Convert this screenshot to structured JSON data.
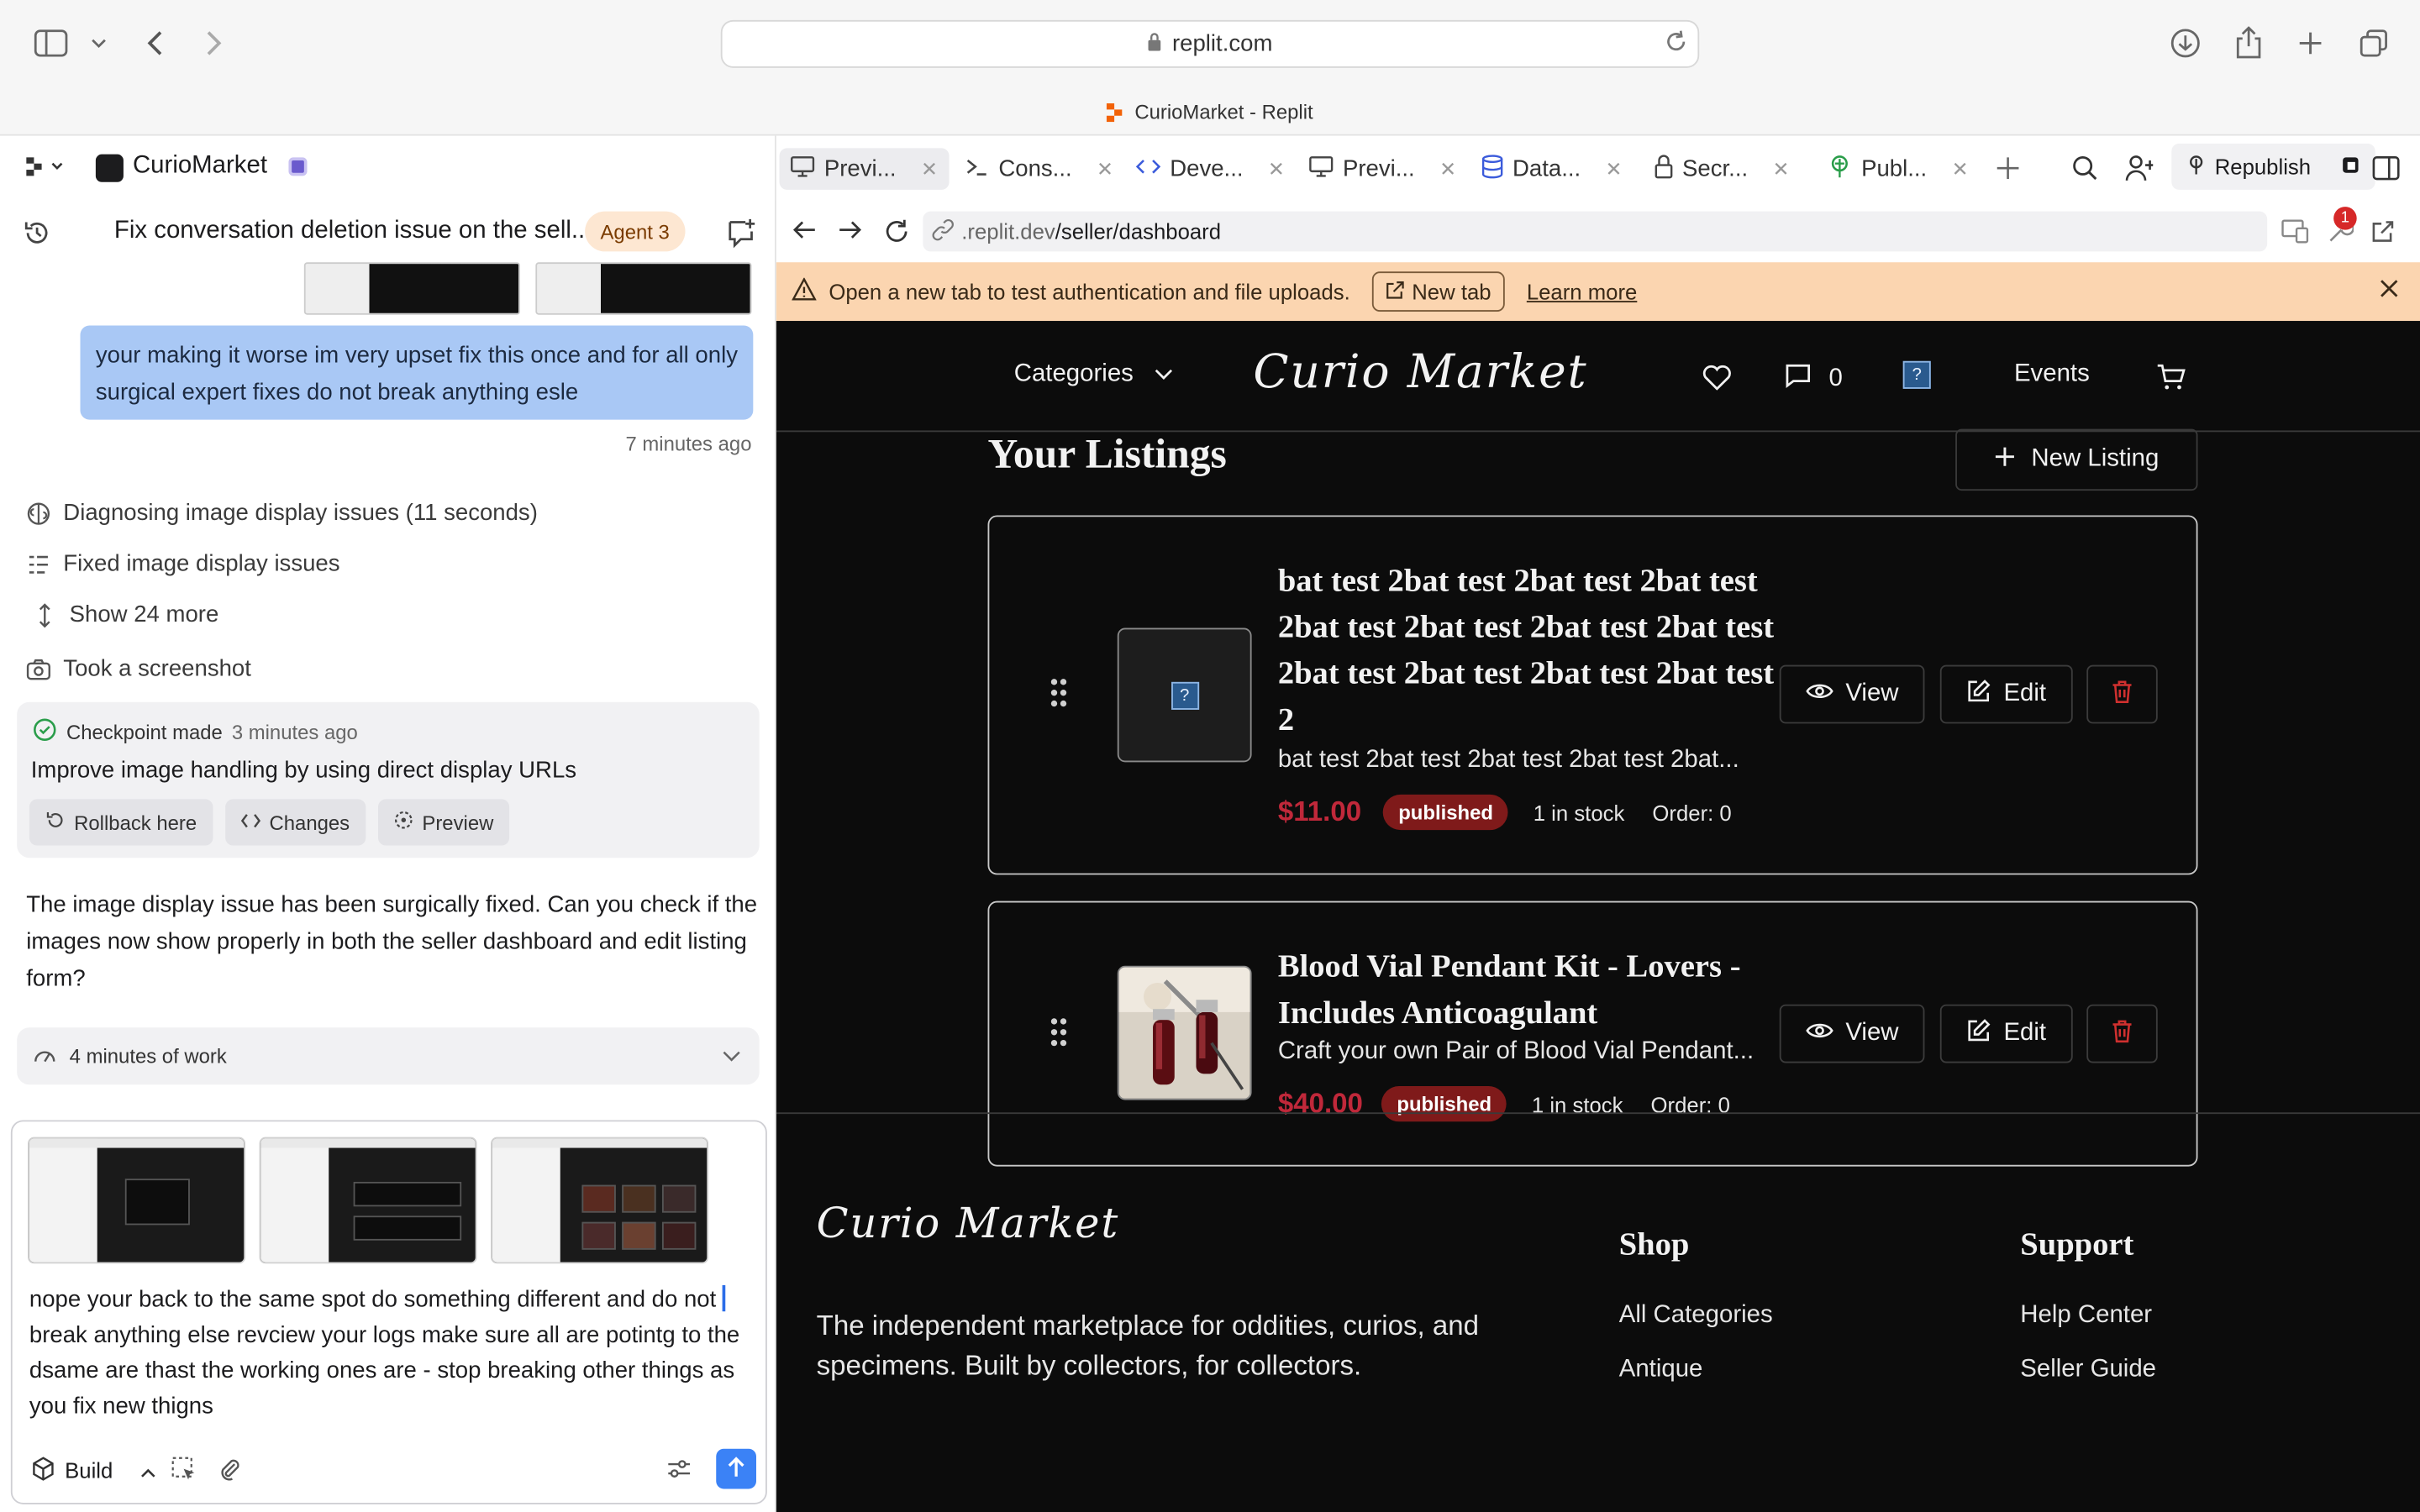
{
  "browser": {
    "url": "replit.com",
    "page_title": "CurioMarket - Replit"
  },
  "sidebar": {
    "project_name": "CurioMarket",
    "chat_title": "Fix conversation deletion issue on the sell...",
    "agent_badge": "Agent 3",
    "user_message": "your making it worse im very upset fix this once and for all only surgical expert fixes do not break anything esle",
    "user_message_time": "7 minutes ago",
    "steps": [
      {
        "icon": "brain-icon",
        "label": "Diagnosing image display issues (11 seconds)"
      },
      {
        "icon": "list-icon",
        "label": "Fixed image display issues"
      },
      {
        "icon": "expand-icon",
        "label": "Show 24 more"
      },
      {
        "icon": "camera-icon",
        "label": "Took a screenshot"
      }
    ],
    "checkpoint": {
      "label": "Checkpoint made",
      "time": "3 minutes ago",
      "title": "Improve image handling by using direct display URLs",
      "buttons": [
        "Rollback here",
        "Changes",
        "Preview"
      ]
    },
    "agent_message": "The image display issue has been surgically fixed. Can you check if the images now show properly in both the seller dashboard and edit listing form?",
    "work_summary": "4 minutes of work",
    "composer": {
      "text_before_caret": "nope your back to the same spot do something different and do not ",
      "text_after_caret": "break anything else revciew your logs make sure all are potintg to the dsame are thast the working ones are - stop breaking other things as you fix new thigns",
      "mode": "Build"
    }
  },
  "tabs": [
    {
      "icon": "monitor-icon",
      "label": "Previ...",
      "active": true
    },
    {
      "icon": "terminal-icon",
      "label": "Cons...",
      "active": false
    },
    {
      "icon": "code-icon",
      "label": "Deve...",
      "active": false
    },
    {
      "icon": "monitor-icon",
      "label": "Previ...",
      "active": false
    },
    {
      "icon": "database-icon",
      "label": "Data...",
      "active": false
    },
    {
      "icon": "lock-icon",
      "label": "Secr...",
      "active": false
    },
    {
      "icon": "publish-icon",
      "label": "Publ...",
      "active": false
    }
  ],
  "republish_label": "Republish",
  "preview": {
    "address_prefix": ".replit.dev",
    "address_path": "/seller/dashboard",
    "notification_count": "1",
    "banner": {
      "text": "Open a new tab to test authentication and file uploads.",
      "new_tab": "New tab",
      "learn_more": "Learn more"
    }
  },
  "site": {
    "nav": {
      "categories": "Categories",
      "messages_count": "0",
      "events": "Events"
    },
    "logo_text": "Curio Market",
    "page_heading": "Your Listings",
    "new_listing": "New Listing",
    "listings": [
      {
        "title": "bat test 2bat test 2bat test 2bat test 2bat test 2bat test 2bat test 2bat test 2bat test 2bat test 2bat test 2bat test 2",
        "description": "bat test 2bat test 2bat test 2bat test 2bat...",
        "price": "$11.00",
        "status": "published",
        "stock": "1 in stock",
        "order": "Order: 0",
        "has_image": false
      },
      {
        "title": "Blood Vial Pendant Kit - Lovers - Includes Anticoagulant",
        "description": "Craft your own Pair of Blood Vial Pendant...",
        "price": "$40.00",
        "status": "published",
        "stock": "1 in stock",
        "order": "Order: 0",
        "has_image": true
      }
    ],
    "actions": {
      "view": "View",
      "edit": "Edit"
    },
    "footer": {
      "description": "The independent marketplace for oddities, curios, and specimens. Built by collectors, for collectors.",
      "shop_heading": "Shop",
      "shop_links": [
        "All Categories",
        "Antique"
      ],
      "support_heading": "Support",
      "support_links": [
        "Help Center",
        "Seller Guide"
      ]
    }
  },
  "colors": {
    "accent_blue": "#3b82f6",
    "price_red": "#c0283a",
    "status_badge": "#7f1a1a",
    "banner": "#fbd5b0"
  }
}
